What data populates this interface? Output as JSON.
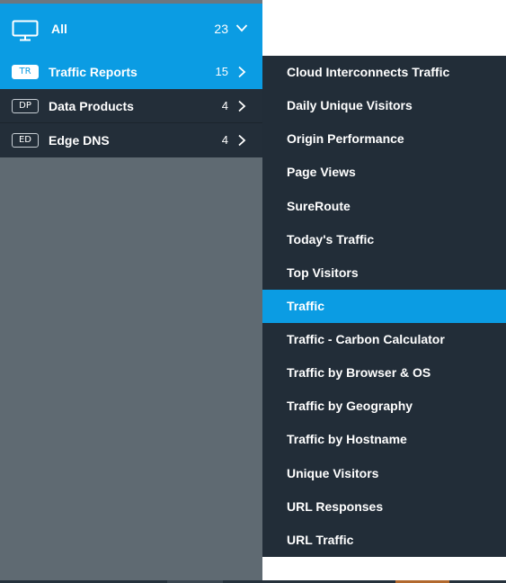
{
  "colors": {
    "accent": "#0b9ce3",
    "menu_dark": "#232e39",
    "backdrop": "#5f6a72"
  },
  "categories": {
    "all": {
      "label": "All",
      "count": "23",
      "icon": "monitor-icon"
    },
    "items": [
      {
        "badge": "TR",
        "label": "Traffic Reports",
        "count": "15",
        "active": true
      },
      {
        "badge": "DP",
        "label": "Data Products",
        "count": "4",
        "active": false
      },
      {
        "badge": "ED",
        "label": "Edge DNS",
        "count": "4",
        "active": false
      }
    ]
  },
  "submenu": {
    "selected": "Traffic",
    "items": [
      "Cloud Interconnects Traffic",
      "Daily Unique Visitors",
      "Origin Performance",
      "Page Views",
      "SureRoute",
      "Today's Traffic",
      "Top Visitors",
      "Traffic",
      "Traffic - Carbon Calculator",
      "Traffic by Browser & OS",
      "Traffic by Geography",
      "Traffic by Hostname",
      "Unique Visitors",
      "URL Responses",
      "URL Traffic"
    ]
  }
}
